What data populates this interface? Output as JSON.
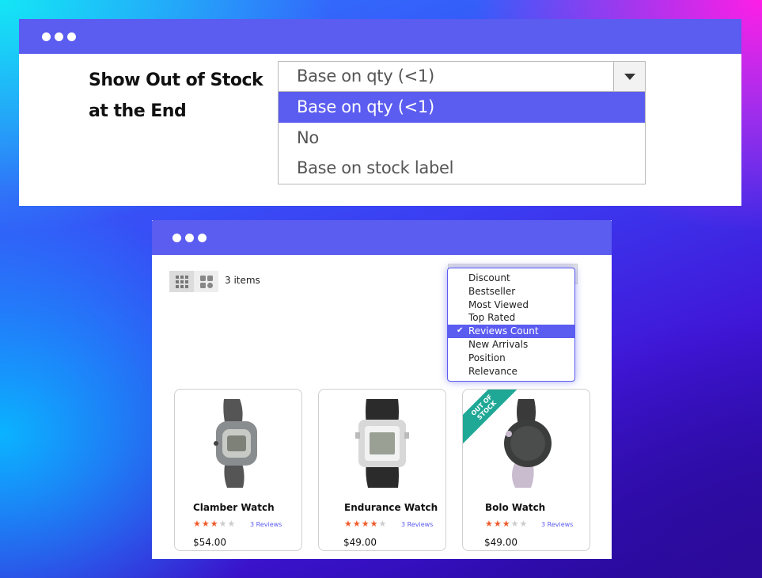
{
  "config_panel": {
    "label": "Show Out of Stock at the End",
    "select_value": "Base on qty (<1)",
    "options": [
      {
        "label": "Base on qty (<1)",
        "selected": true
      },
      {
        "label": "No",
        "selected": false
      },
      {
        "label": "Base on stock label",
        "selected": false
      }
    ]
  },
  "storefront": {
    "items_count": "3 items",
    "sort_options": [
      {
        "label": "Discount",
        "selected": false
      },
      {
        "label": "Bestseller",
        "selected": false
      },
      {
        "label": "Most Viewed",
        "selected": false
      },
      {
        "label": "Top Rated",
        "selected": false
      },
      {
        "label": "Reviews Count",
        "selected": true
      },
      {
        "label": "New Arrivals",
        "selected": false
      },
      {
        "label": "Position",
        "selected": false
      },
      {
        "label": "Relevance",
        "selected": false
      }
    ],
    "products": [
      {
        "name": "Clamber Watch",
        "rating": 3,
        "max_rating": 5,
        "reviews": "3 Reviews",
        "price": "$54.00",
        "out_of_stock": false
      },
      {
        "name": "Endurance Watch",
        "rating": 4,
        "max_rating": 5,
        "reviews": "3 Reviews",
        "price": "$49.00",
        "out_of_stock": false
      },
      {
        "name": "Bolo Watch",
        "rating": 3,
        "max_rating": 5,
        "reviews": "3 Reviews",
        "price": "$49.00",
        "out_of_stock": true,
        "badge": "OUT OF STOCK"
      }
    ]
  },
  "colors": {
    "accent": "#5b5cf0",
    "star": "#ef5a2a",
    "badge": "#1fa896"
  }
}
